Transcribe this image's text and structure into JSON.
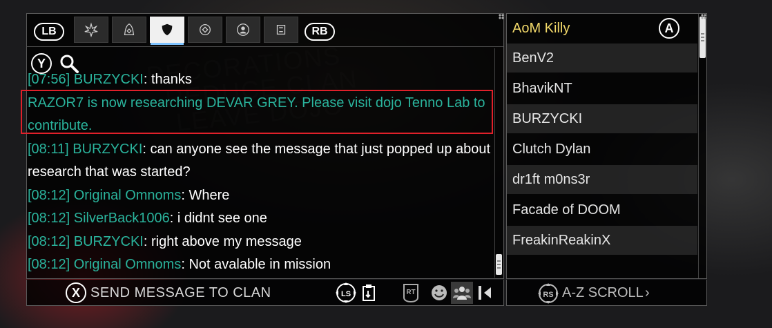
{
  "tabs": {
    "left_bumper": "LB",
    "right_bumper": "RB",
    "items": [
      {
        "icon": "lotus-icon"
      },
      {
        "icon": "hood-icon"
      },
      {
        "icon": "shield-icon",
        "active": true
      },
      {
        "icon": "alliance-crest-icon"
      },
      {
        "icon": "person-circle-icon"
      },
      {
        "icon": "trade-icon"
      }
    ]
  },
  "search": {
    "button": "Y",
    "icon": "magnifier-icon"
  },
  "messages": [
    {
      "ts": "[07:56]",
      "sender": "BURZYCKI",
      "text": ": thanks"
    },
    {
      "system": "RAZOR7 is now researching DEVAR GREY. Please visit dojo Tenno Lab to contribute."
    },
    {
      "ts": "[08:11]",
      "sender": "BURZYCKI",
      "text": ": can anyone see the message that just popped up about research that was started?"
    },
    {
      "ts": "[08:12]",
      "sender": "Original Omnoms",
      "text": ": Where"
    },
    {
      "ts": "[08:12]",
      "sender": "SilverBack1006",
      "text": ": i didnt see one"
    },
    {
      "ts": "[08:12]",
      "sender": "BURZYCKI",
      "text": ": right above my message"
    },
    {
      "ts": "[08:12]",
      "sender": "Original Omnoms",
      "text": ": Not avalable in mission"
    }
  ],
  "bottom_bar": {
    "send_button": "X",
    "send_label": "SEND MESSAGE TO CLAN",
    "ls_label": "LS",
    "rt_label": "RT"
  },
  "roster": {
    "a_button": "A",
    "members": [
      {
        "name": "AoM Killy",
        "self": true
      },
      {
        "name": "BenV2"
      },
      {
        "name": "BhavikNT"
      },
      {
        "name": "BURZYCKI"
      },
      {
        "name": "Clutch Dylan"
      },
      {
        "name": "dr1ft m0ns3r"
      },
      {
        "name": "Facade of DOOM"
      },
      {
        "name": "FreakinReakinX"
      }
    ],
    "rs_label": "RS",
    "scroll_label": "A-Z SCROLL",
    "scroll_arrow": "›"
  },
  "colors": {
    "accent_teal": "#2ab39c",
    "self_name": "#f3d96a",
    "highlight_red": "#e0202a"
  }
}
